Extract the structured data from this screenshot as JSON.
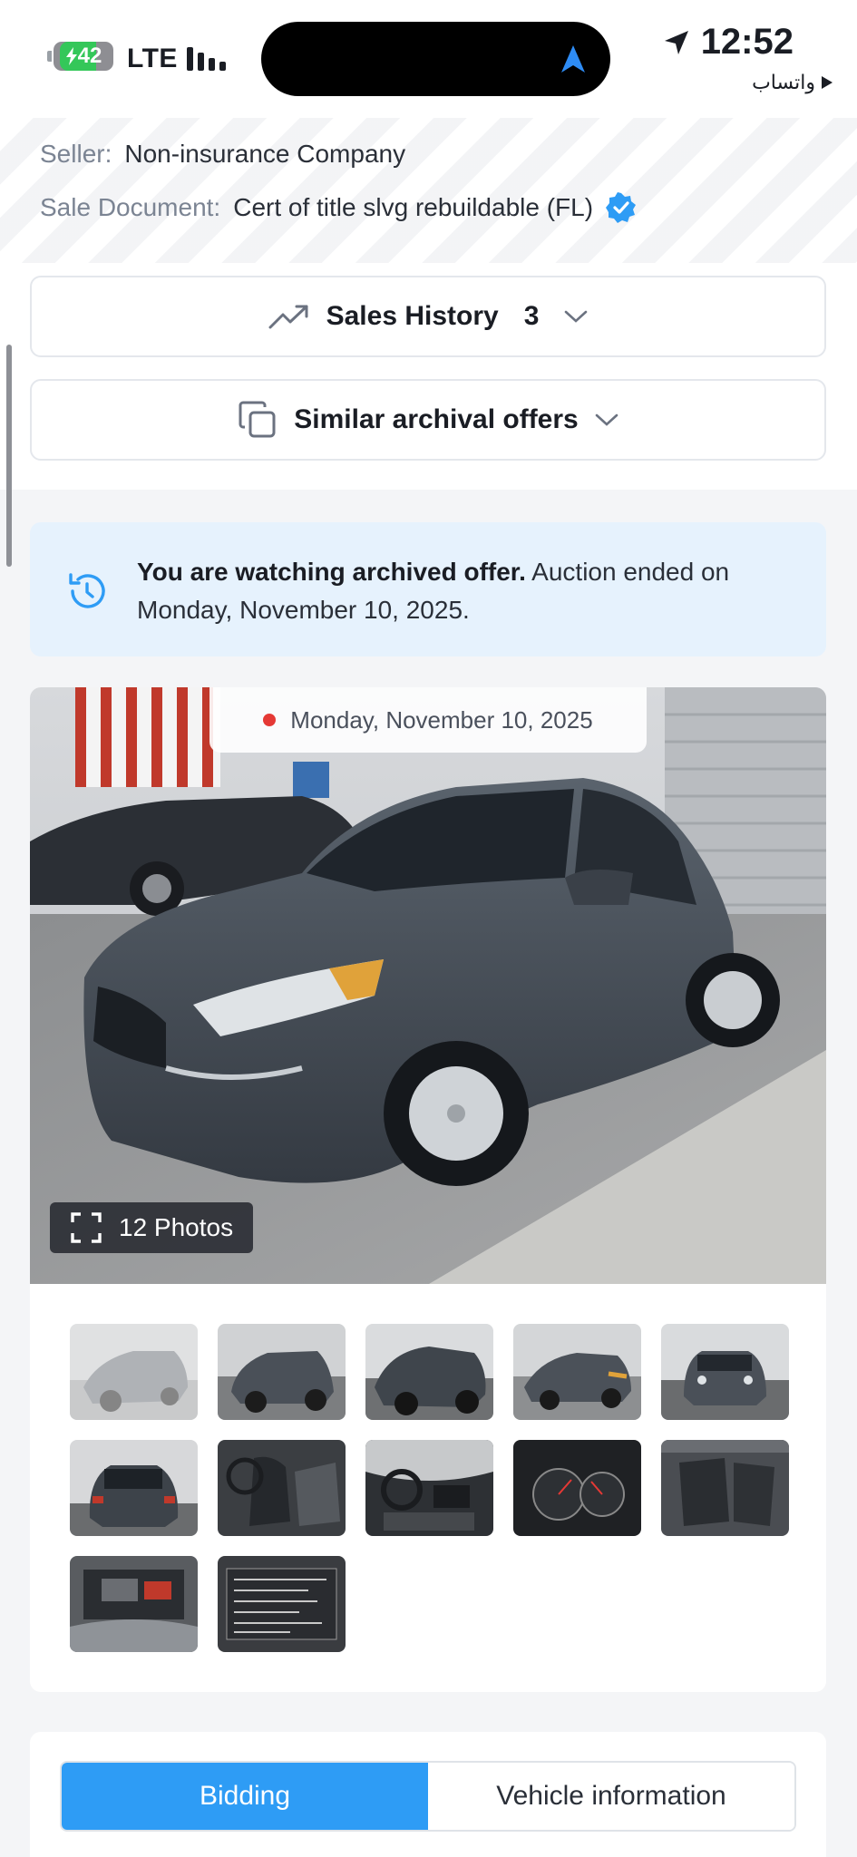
{
  "status_bar": {
    "battery": "42",
    "network": "LTE",
    "time": "12:52",
    "back_app": "واتساب"
  },
  "seller": {
    "seller_label": "Seller:",
    "seller_value": "Non-insurance Company",
    "doc_label": "Sale Document:",
    "doc_value": "Cert of title slvg rebuildable (FL)"
  },
  "sales_history": {
    "label": "Sales History",
    "count": "3"
  },
  "similar_offers": {
    "label": "Similar archival offers"
  },
  "notice": {
    "bold": "You are watching archived offer.",
    "rest": " Auction ended on Monday, November 10, 2025."
  },
  "gallery": {
    "date": "Monday, November 10, 2025",
    "photos_label": "12 Photos",
    "thumbnails": [
      "thumb-front-left-faded",
      "thumb-rear-left",
      "thumb-rear-left-2",
      "thumb-front-right",
      "thumb-front",
      "thumb-rear",
      "thumb-driver-seat",
      "thumb-dashboard",
      "thumb-gauges",
      "thumb-rear-seats",
      "thumb-engine",
      "thumb-vin-label"
    ]
  },
  "tabs": [
    {
      "label": "Bidding",
      "active": true
    },
    {
      "label": "Vehicle information",
      "active": false
    }
  ],
  "colors": {
    "accent": "#2e9cf5",
    "notice_bg": "#e6f2fd",
    "verified": "#2e9cf5",
    "live_dot": "#e53935"
  }
}
